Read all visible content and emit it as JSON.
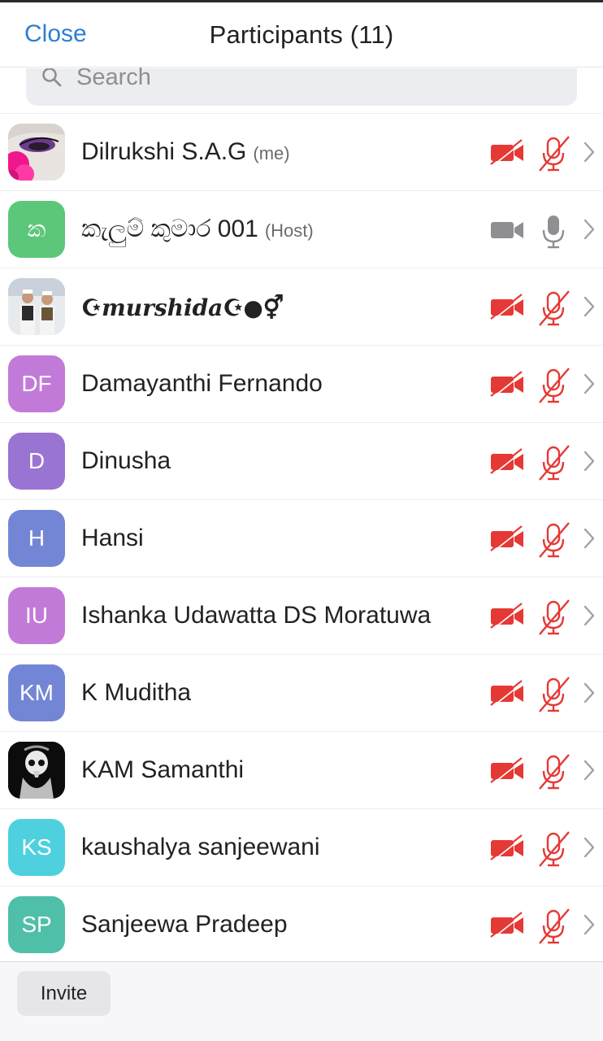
{
  "header": {
    "close_label": "Close",
    "title": "Participants (11)"
  },
  "search": {
    "placeholder": "Search",
    "icon": "search-icon"
  },
  "colors": {
    "accent": "#2d7fd3",
    "muted_red": "#e53935",
    "unmuted_gray": "#8e8e93"
  },
  "participants": [
    {
      "name": "Dilrukshi S.A.G",
      "tag": "(me)",
      "avatar_type": "photo",
      "avatar_desc": "makeup-eye-photo",
      "video_on": false,
      "audio_muted": true
    },
    {
      "name": "කැලුම් කුමාර 001",
      "tag": "(Host)",
      "avatar_type": "initials",
      "initials": "ක",
      "avatar_color": "#5cc77a",
      "video_on": false,
      "audio_muted": false,
      "icons_gray": true
    },
    {
      "name": "murshida",
      "tag": "",
      "avatar_type": "photo",
      "avatar_desc": "two-children-photo",
      "video_on": false,
      "audio_muted": true
    },
    {
      "name": "Damayanthi Fernando",
      "tag": "",
      "avatar_type": "initials",
      "initials": "DF",
      "avatar_color": "#c27ad8",
      "video_on": false,
      "audio_muted": true
    },
    {
      "name": "Dinusha",
      "tag": "",
      "avatar_type": "initials",
      "initials": "D",
      "avatar_color": "#9a74d2",
      "video_on": false,
      "audio_muted": true
    },
    {
      "name": "Hansi",
      "tag": "",
      "avatar_type": "initials",
      "initials": "H",
      "avatar_color": "#7386d6",
      "video_on": false,
      "audio_muted": true
    },
    {
      "name": "Ishanka Udawatta DS Moratuwa",
      "tag": "",
      "avatar_type": "initials",
      "initials": "IU",
      "avatar_color": "#c27ad8",
      "video_on": false,
      "audio_muted": true
    },
    {
      "name": "K Muditha",
      "tag": "",
      "avatar_type": "initials",
      "initials": "KM",
      "avatar_color": "#7386d6",
      "video_on": false,
      "audio_muted": true
    },
    {
      "name": "KAM Samanthi",
      "tag": "",
      "avatar_type": "photo",
      "avatar_desc": "skull-art-photo",
      "video_on": false,
      "audio_muted": true
    },
    {
      "name": "kaushalya sanjeewani",
      "tag": "",
      "avatar_type": "initials",
      "initials": "KS",
      "avatar_color": "#4fd0de",
      "video_on": false,
      "audio_muted": true
    },
    {
      "name": "Sanjeewa Pradeep",
      "tag": "",
      "avatar_type": "initials",
      "initials": "SP",
      "avatar_color": "#4fbfa9",
      "video_on": false,
      "audio_muted": true
    }
  ],
  "footer": {
    "invite_label": "Invite"
  }
}
